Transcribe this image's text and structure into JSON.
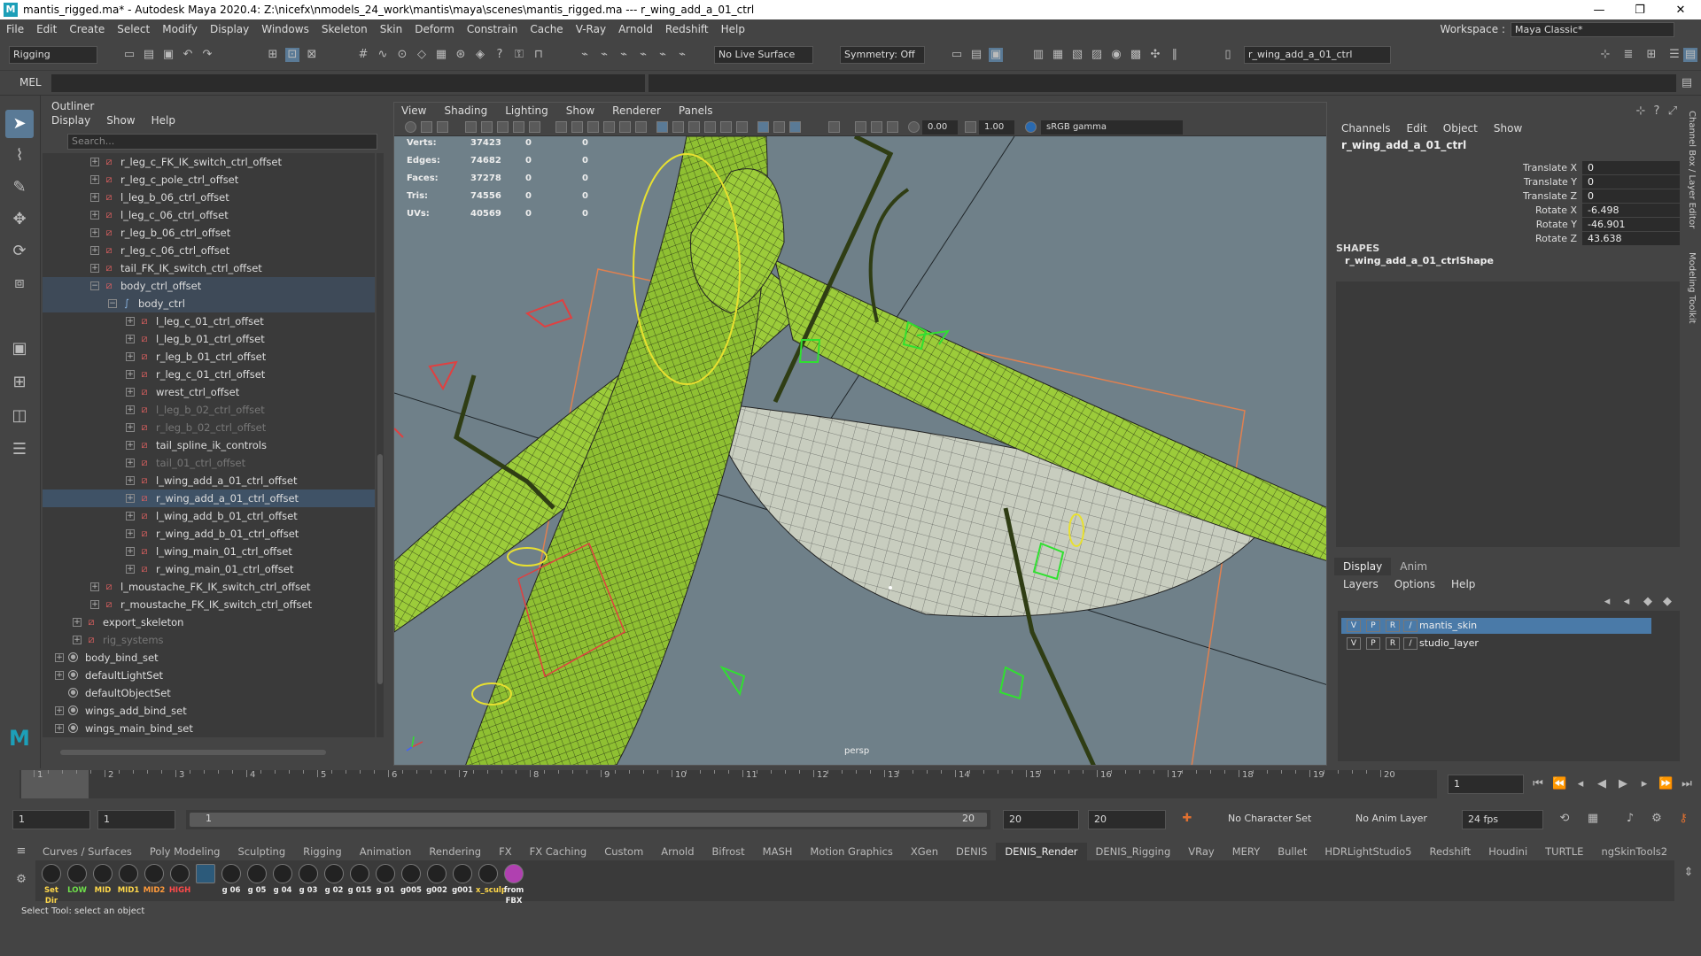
{
  "title": {
    "app": "mantis_rigged.ma* - Autodesk Maya 2020.4: Z:\\nicefx\\nmodels_24_work\\mantis\\maya\\scenes\\mantis_rigged.ma   ---   r_wing_add_a_01_ctrl",
    "min": "—",
    "max": "❐",
    "close": "✕"
  },
  "menu": [
    "File",
    "Edit",
    "Create",
    "Select",
    "Modify",
    "Display",
    "Windows",
    "Skeleton",
    "Skin",
    "Deform",
    "Constrain",
    "Cache",
    "V-Ray",
    "Arnold",
    "Redshift",
    "Help"
  ],
  "workspace": {
    "label": "Workspace :",
    "value": "Maya Classic*"
  },
  "toolbar": {
    "menuset": "Rigging",
    "live_surface": "No Live Surface",
    "symmetry": "Symmetry: Off",
    "object_field": "r_wing_add_a_01_ctrl"
  },
  "mel": {
    "label": "MEL"
  },
  "outliner": {
    "title": "Outliner",
    "menu": [
      "Display",
      "Show",
      "Help"
    ],
    "search_placeholder": "Search...",
    "rows": [
      {
        "label": "r_leg_c_FK_IK_switch_ctrl_offset",
        "indent": 2,
        "state": ""
      },
      {
        "label": "r_leg_c_pole_ctrl_offset",
        "indent": 2,
        "state": ""
      },
      {
        "label": "l_leg_b_06_ctrl_offset",
        "indent": 2,
        "state": ""
      },
      {
        "label": "l_leg_c_06_ctrl_offset",
        "indent": 2,
        "state": ""
      },
      {
        "label": "r_leg_b_06_ctrl_offset",
        "indent": 2,
        "state": ""
      },
      {
        "label": "r_leg_c_06_ctrl_offset",
        "indent": 2,
        "state": ""
      },
      {
        "label": "tail_FK_IK_switch_ctrl_offset",
        "indent": 2,
        "state": ""
      },
      {
        "label": "body_ctrl_offset",
        "indent": 2,
        "state": "hl",
        "open": true
      },
      {
        "label": "body_ctrl",
        "indent": 3,
        "state": "hl",
        "open": true,
        "curve": true
      },
      {
        "label": "l_leg_c_01_ctrl_offset",
        "indent": 4,
        "state": ""
      },
      {
        "label": "l_leg_b_01_ctrl_offset",
        "indent": 4,
        "state": ""
      },
      {
        "label": "r_leg_b_01_ctrl_offset",
        "indent": 4,
        "state": ""
      },
      {
        "label": "r_leg_c_01_ctrl_offset",
        "indent": 4,
        "state": ""
      },
      {
        "label": "wrest_ctrl_offset",
        "indent": 4,
        "state": ""
      },
      {
        "label": "l_leg_b_02_ctrl_offset",
        "indent": 4,
        "state": "dim"
      },
      {
        "label": "r_leg_b_02_ctrl_offset",
        "indent": 4,
        "state": "dim"
      },
      {
        "label": "tail_spline_ik_controls",
        "indent": 4,
        "state": ""
      },
      {
        "label": "tail_01_ctrl_offset",
        "indent": 4,
        "state": "dim"
      },
      {
        "label": "l_wing_add_a_01_ctrl_offset",
        "indent": 4,
        "state": ""
      },
      {
        "label": "r_wing_add_a_01_ctrl_offset",
        "indent": 4,
        "state": "sel"
      },
      {
        "label": "l_wing_add_b_01_ctrl_offset",
        "indent": 4,
        "state": ""
      },
      {
        "label": "r_wing_add_b_01_ctrl_offset",
        "indent": 4,
        "state": ""
      },
      {
        "label": "l_wing_main_01_ctrl_offset",
        "indent": 4,
        "state": ""
      },
      {
        "label": "r_wing_main_01_ctrl_offset",
        "indent": 4,
        "state": ""
      },
      {
        "label": "l_moustache_FK_IK_switch_ctrl_offset",
        "indent": 2,
        "state": ""
      },
      {
        "label": "r_moustache_FK_IK_switch_ctrl_offset",
        "indent": 2,
        "state": ""
      },
      {
        "label": "export_skeleton",
        "indent": 1,
        "state": ""
      },
      {
        "label": "rig_systems",
        "indent": 1,
        "state": "dim"
      },
      {
        "label": "body_bind_set",
        "indent": 0,
        "state": "",
        "set": true
      },
      {
        "label": "defaultLightSet",
        "indent": 0,
        "state": "",
        "set": true
      },
      {
        "label": "defaultObjectSet",
        "indent": 0,
        "state": "",
        "set": true,
        "noexp": true
      },
      {
        "label": "wings_add_bind_set",
        "indent": 0,
        "state": "",
        "set": true
      },
      {
        "label": "wings_main_bind_set",
        "indent": 0,
        "state": "",
        "set": true
      }
    ]
  },
  "viewport": {
    "menu": [
      "View",
      "Shading",
      "Lighting",
      "Show",
      "Renderer",
      "Panels"
    ],
    "field_a": "0.00",
    "field_b": "1.00",
    "color_space": "sRGB gamma",
    "camera": "persp",
    "hud": [
      {
        "k": "Verts:",
        "v": "37423",
        "a": "0",
        "b": "0"
      },
      {
        "k": "Edges:",
        "v": "74682",
        "a": "0",
        "b": "0"
      },
      {
        "k": "Faces:",
        "v": "37278",
        "a": "0",
        "b": "0"
      },
      {
        "k": "Tris:",
        "v": "74556",
        "a": "0",
        "b": "0"
      },
      {
        "k": "UVs:",
        "v": "40569",
        "a": "0",
        "b": "0"
      }
    ],
    "bg_color": "#6f8089",
    "mesh_color": "#9ccc3a"
  },
  "channelbox": {
    "menu": [
      "Channels",
      "Edit",
      "Object",
      "Show"
    ],
    "object": "r_wing_add_a_01_ctrl",
    "channels": [
      {
        "label": "Translate X",
        "value": "0"
      },
      {
        "label": "Translate Y",
        "value": "0"
      },
      {
        "label": "Translate Z",
        "value": "0"
      },
      {
        "label": "Rotate X",
        "value": "-6.498"
      },
      {
        "label": "Rotate Y",
        "value": "-46.901"
      },
      {
        "label": "Rotate Z",
        "value": "43.638"
      }
    ],
    "shapes_label": "SHAPES",
    "shape": "r_wing_add_a_01_ctrlShape"
  },
  "side_tabs": [
    "Channel Box / Layer Editor",
    "Modeling Toolkit"
  ],
  "layers": {
    "tabs": [
      "Display",
      "Anim"
    ],
    "menu": [
      "Layers",
      "Options",
      "Help"
    ],
    "rows": [
      {
        "v": "V",
        "p": "P",
        "r": "R",
        "name": "mantis_skin",
        "active": true
      },
      {
        "v": "V",
        "p": "P",
        "r": "R",
        "name": "studio_layer",
        "active": false
      }
    ]
  },
  "timeline": {
    "ticks": [
      "1",
      "2",
      "3",
      "4",
      "5",
      "6",
      "7",
      "8",
      "9",
      "10",
      "11",
      "12",
      "13",
      "14",
      "15",
      "16",
      "17",
      "18",
      "19",
      "20"
    ],
    "current": "1"
  },
  "range": {
    "start": "1",
    "anim_start": "1",
    "slider_start": "1",
    "slider_end": "20",
    "anim_end": "20",
    "end": "20",
    "char_set": "No Character Set",
    "anim_layer": "No Anim Layer",
    "fps": "24 fps"
  },
  "shelf": {
    "tabs": [
      "Curves / Surfaces",
      "Poly Modeling",
      "Sculpting",
      "Rigging",
      "Animation",
      "Rendering",
      "FX",
      "FX Caching",
      "Custom",
      "Arnold",
      "Bifrost",
      "MASH",
      "Motion Graphics",
      "XGen",
      "DENIS",
      "DENIS_Render",
      "DENIS_Rigging",
      "VRay",
      "MERY",
      "Bullet",
      "HDRLightStudio5",
      "Redshift",
      "Houdini",
      "TURTLE",
      "ngSkinTools2"
    ],
    "active": "DENIS_Render",
    "icons": [
      {
        "label": "Set Dir",
        "color": "#ffd84a"
      },
      {
        "label": "LOW",
        "color": "#6fe04a"
      },
      {
        "label": "MID",
        "color": "#ffd84a"
      },
      {
        "label": "MID1",
        "color": "#ffd84a"
      },
      {
        "label": "MID2",
        "color": "#ff9a3a"
      },
      {
        "label": "HIGH",
        "color": "#ff4a4a"
      },
      {
        "label": "",
        "color": "#eeeeee"
      },
      {
        "label": "g 06",
        "color": "#eeeeee"
      },
      {
        "label": "g 05",
        "color": "#eeeeee"
      },
      {
        "label": "g 04",
        "color": "#eeeeee"
      },
      {
        "label": "g 03",
        "color": "#eeeeee"
      },
      {
        "label": "g 02",
        "color": "#eeeeee"
      },
      {
        "label": "g 015",
        "color": "#eeeeee"
      },
      {
        "label": "g 01",
        "color": "#eeeeee"
      },
      {
        "label": "g005",
        "color": "#eeeeee"
      },
      {
        "label": "g002",
        "color": "#eeeeee"
      },
      {
        "label": "g001",
        "color": "#eeeeee"
      },
      {
        "label": "x_sculp",
        "color": "#ffd84a"
      },
      {
        "label": "from FBX",
        "color": "#eeeeee"
      }
    ]
  },
  "help": "Select Tool: select an object"
}
